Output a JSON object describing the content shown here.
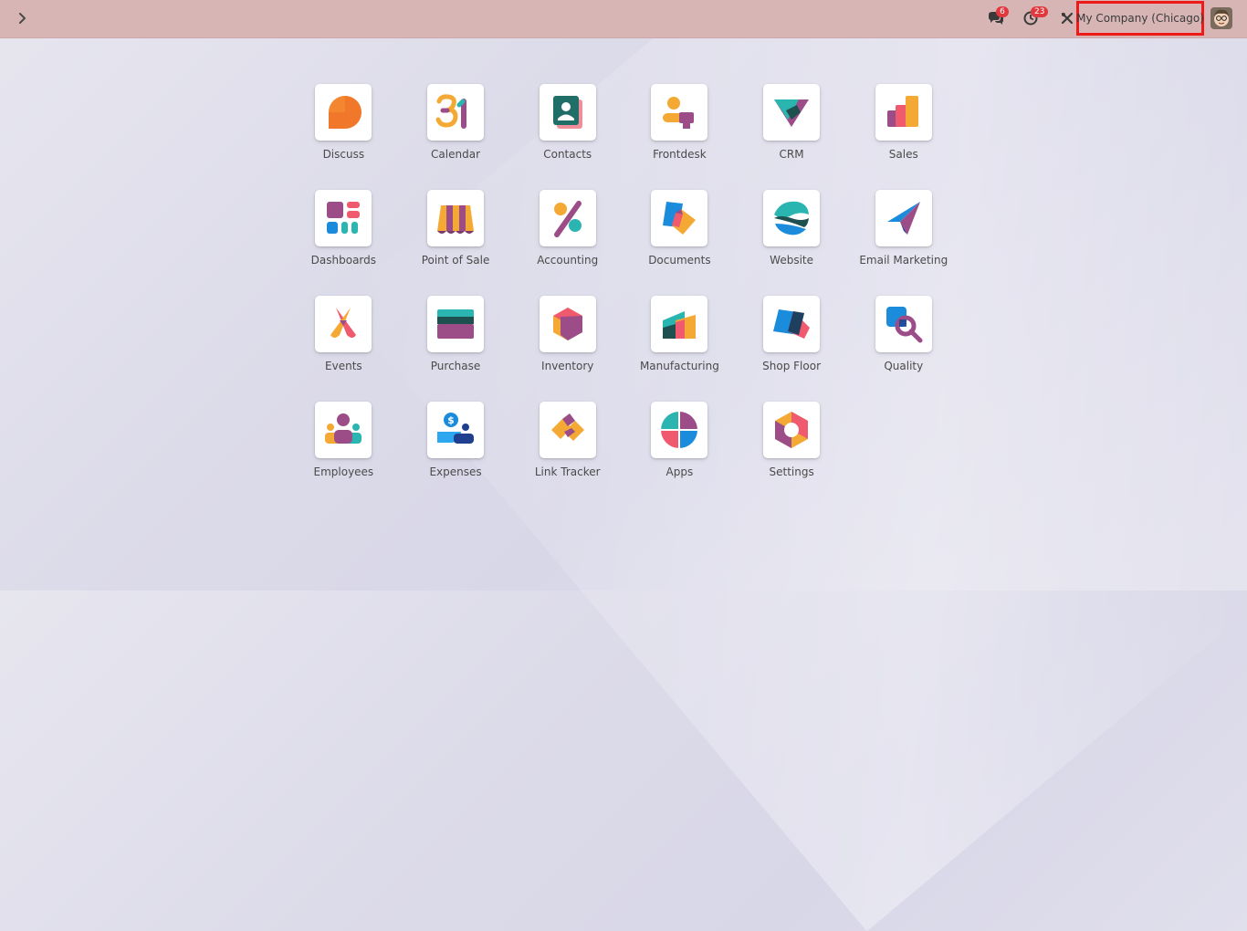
{
  "topbar": {
    "messages_badge": "6",
    "activities_badge": "23",
    "company_name": "My Company (Chicago)"
  },
  "apps": [
    {
      "label": "Discuss",
      "icon": "discuss-icon"
    },
    {
      "label": "Calendar",
      "icon": "calendar-icon"
    },
    {
      "label": "Contacts",
      "icon": "contacts-icon"
    },
    {
      "label": "Frontdesk",
      "icon": "frontdesk-icon"
    },
    {
      "label": "CRM",
      "icon": "crm-icon"
    },
    {
      "label": "Sales",
      "icon": "sales-icon"
    },
    {
      "label": "Dashboards",
      "icon": "dashboards-icon"
    },
    {
      "label": "Point of Sale",
      "icon": "point-of-sale-icon"
    },
    {
      "label": "Accounting",
      "icon": "accounting-icon"
    },
    {
      "label": "Documents",
      "icon": "documents-icon"
    },
    {
      "label": "Website",
      "icon": "website-icon"
    },
    {
      "label": "Email Marketing",
      "icon": "email-marketing-icon"
    },
    {
      "label": "Events",
      "icon": "events-icon"
    },
    {
      "label": "Purchase",
      "icon": "purchase-icon"
    },
    {
      "label": "Inventory",
      "icon": "inventory-icon"
    },
    {
      "label": "Manufacturing",
      "icon": "manufacturing-icon"
    },
    {
      "label": "Shop Floor",
      "icon": "shop-floor-icon"
    },
    {
      "label": "Quality",
      "icon": "quality-icon"
    },
    {
      "label": "Employees",
      "icon": "employees-icon"
    },
    {
      "label": "Expenses",
      "icon": "expenses-icon"
    },
    {
      "label": "Link Tracker",
      "icon": "link-tracker-icon"
    },
    {
      "label": "Apps",
      "icon": "apps-icon"
    },
    {
      "label": "Settings",
      "icon": "settings-icon"
    }
  ],
  "colors": {
    "topbar": "#d8b5b5",
    "highlight": "#ee1a1a",
    "badge": "#e0383e"
  }
}
